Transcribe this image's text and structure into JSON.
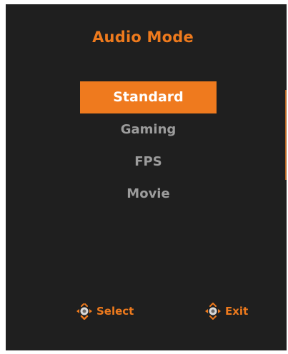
{
  "menu": {
    "title": "Audio Mode",
    "items": [
      {
        "label": "Standard",
        "selected": true
      },
      {
        "label": "Gaming",
        "selected": false
      },
      {
        "label": "FPS",
        "selected": false
      },
      {
        "label": "Movie",
        "selected": false
      }
    ]
  },
  "footer": {
    "select_label": "Select",
    "exit_label": "Exit"
  },
  "icons": {
    "select": "joystick-nav-icon",
    "exit": "joystick-nav-icon"
  },
  "colors": {
    "accent": "#ef7a1e",
    "panel_background": "#1f1f1f",
    "inactive_text": "#9c9c9c",
    "selected_text": "#ffffff"
  }
}
